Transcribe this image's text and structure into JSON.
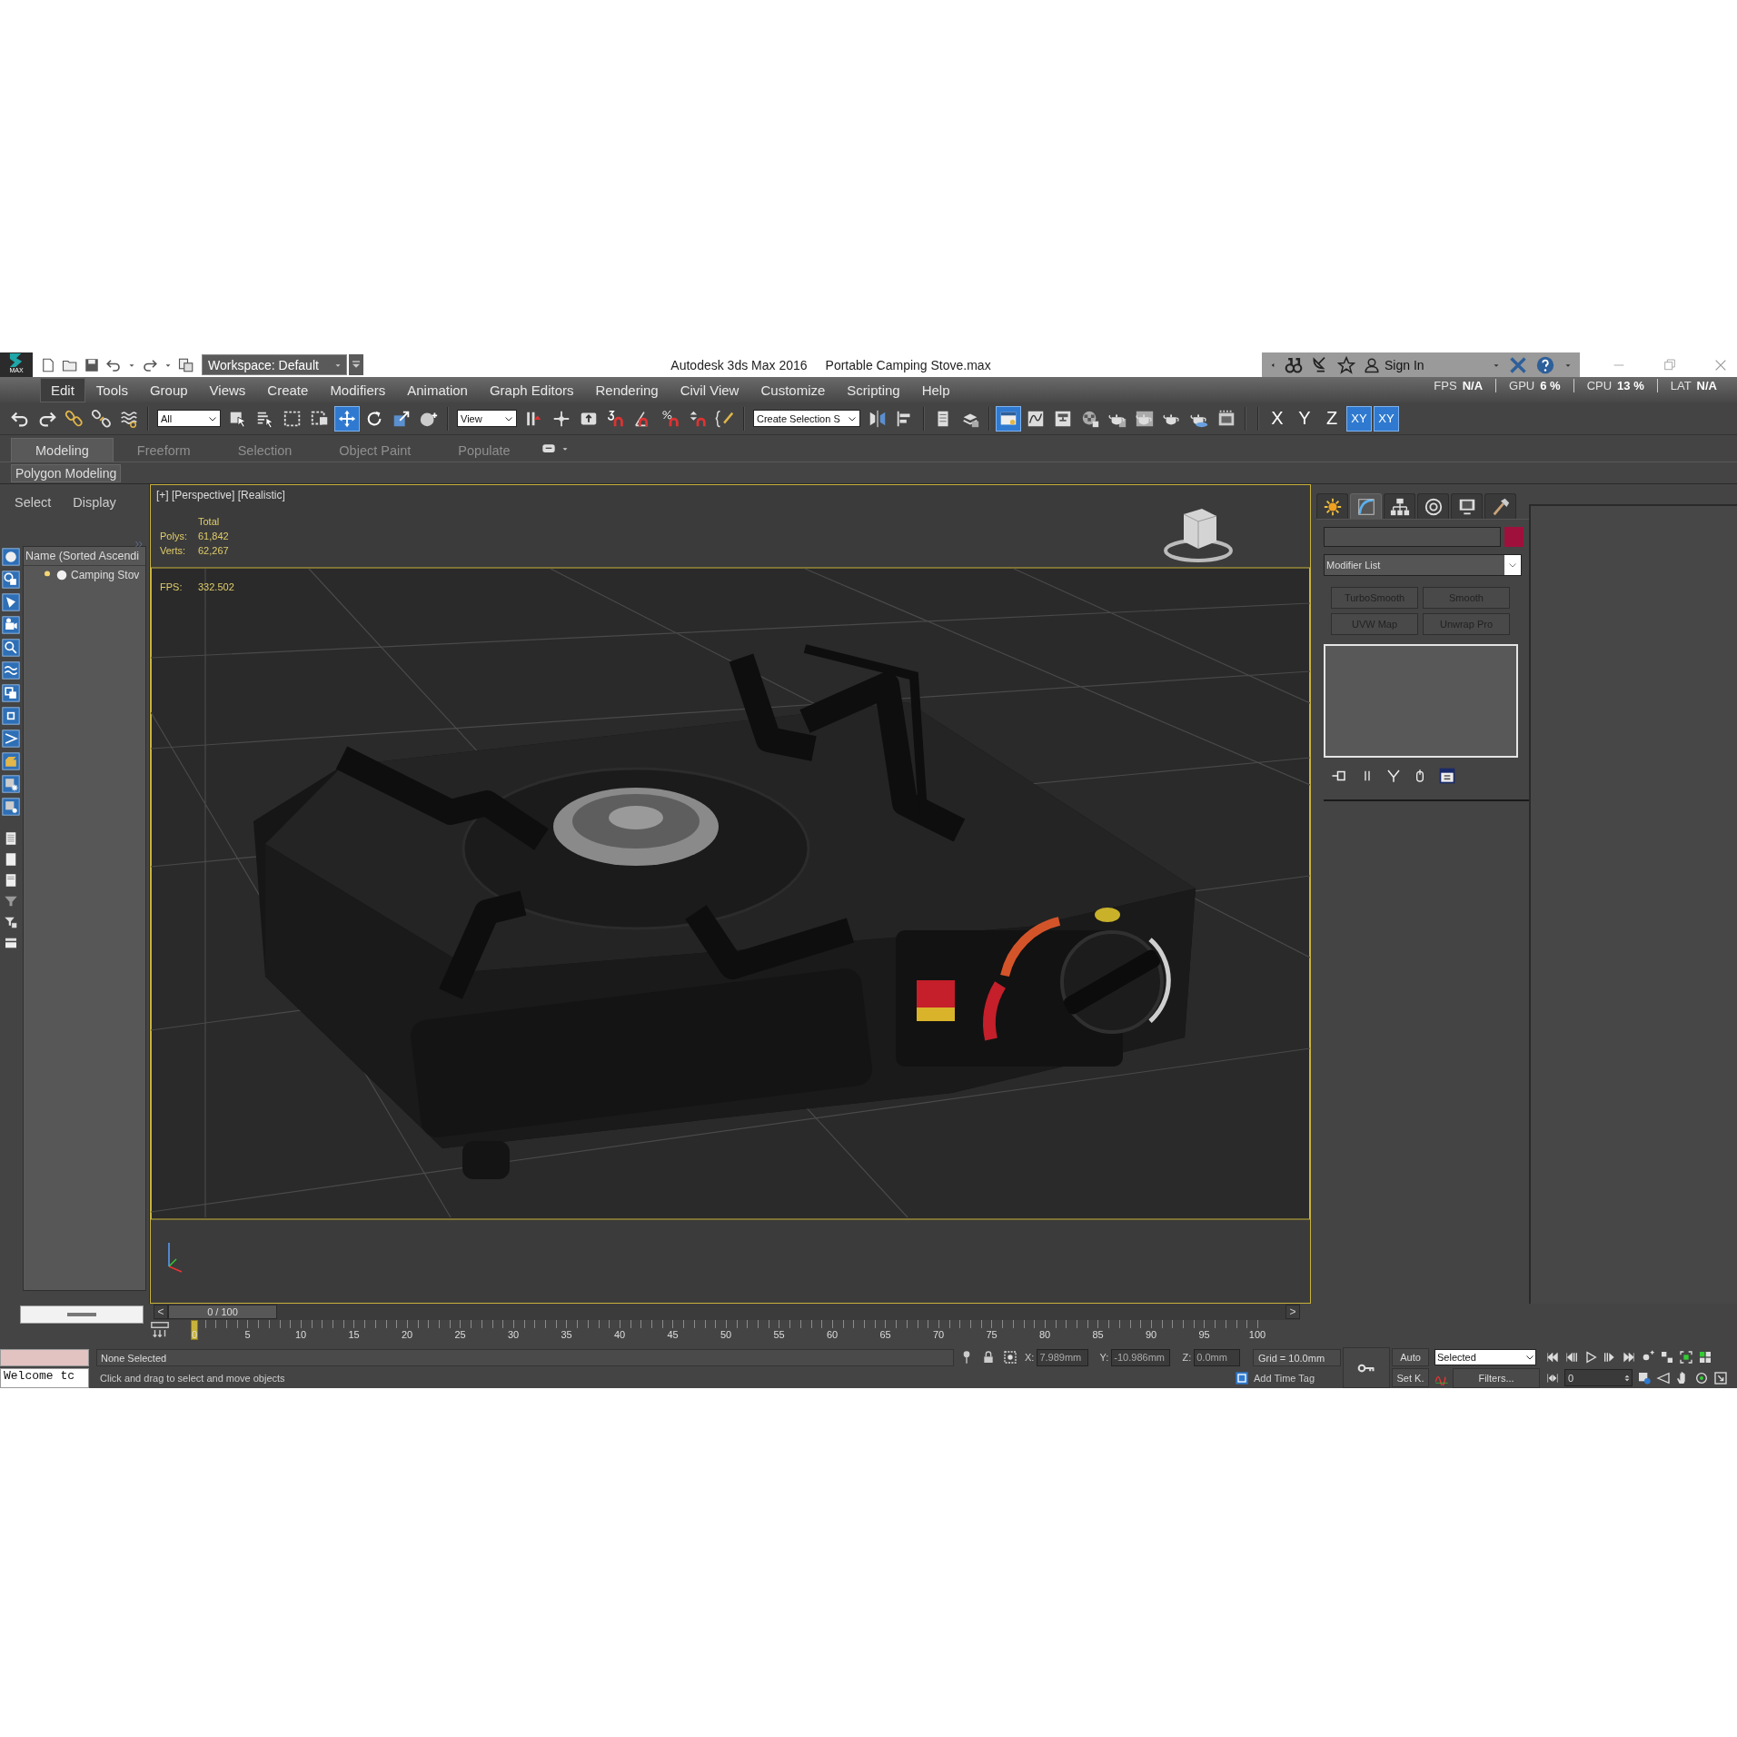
{
  "title_bar": {
    "app_menu_label": "MAX",
    "workspace": "Workspace: Default",
    "app_title": "Autodesk 3ds Max 2016",
    "file_name": "Portable Camping Stove.max",
    "sign_in": "Sign In"
  },
  "menu_bar": {
    "items": [
      {
        "label": "Edit",
        "selected": true
      },
      {
        "label": "Tools",
        "selected": false
      },
      {
        "label": "Group",
        "selected": false
      },
      {
        "label": "Views",
        "selected": false
      },
      {
        "label": "Create",
        "selected": false
      },
      {
        "label": "Modifiers",
        "selected": false
      },
      {
        "label": "Animation",
        "selected": false
      },
      {
        "label": "Graph Editors",
        "selected": false
      },
      {
        "label": "Rendering",
        "selected": false
      },
      {
        "label": "Civil View",
        "selected": false
      },
      {
        "label": "Customize",
        "selected": false
      },
      {
        "label": "Scripting",
        "selected": false
      },
      {
        "label": "Help",
        "selected": false
      }
    ],
    "performance": [
      {
        "label": "FPS",
        "value": "N/A"
      },
      {
        "label": "GPU",
        "value": "6 %"
      },
      {
        "label": "CPU",
        "value": "13 %"
      },
      {
        "label": "LAT",
        "value": "N/A"
      }
    ]
  },
  "main_toolbar": {
    "items": [
      {
        "kind": "undo",
        "selected": false
      },
      {
        "kind": "redo",
        "selected": false
      },
      {
        "kind": "link",
        "selected": false
      },
      {
        "kind": "unlink",
        "selected": false
      },
      {
        "kind": "bind",
        "selected": false
      },
      {
        "kind": "dropdown",
        "value": "All"
      },
      {
        "kind": "select",
        "selected": false
      },
      {
        "kind": "select-by-name",
        "selected": false
      },
      {
        "kind": "region",
        "selected": false
      },
      {
        "kind": "crossing",
        "selected": false
      },
      {
        "kind": "move",
        "selected": true
      },
      {
        "kind": "rotate",
        "selected": false
      },
      {
        "kind": "scale",
        "selected": false
      },
      {
        "kind": "placement",
        "selected": false
      },
      {
        "kind": "dropdown",
        "value": "View"
      },
      {
        "kind": "pivot",
        "selected": false
      },
      {
        "kind": "manipulate",
        "selected": false
      },
      {
        "kind": "shortcut",
        "selected": false
      },
      {
        "kind": "snap",
        "selected": false
      },
      {
        "kind": "angle-snap",
        "selected": false
      },
      {
        "kind": "percent-snap",
        "selected": false
      },
      {
        "kind": "spinner-snap",
        "selected": false
      },
      {
        "kind": "named-sets",
        "selected": false
      },
      {
        "kind": "dropdown",
        "value": "Create Selection S"
      },
      {
        "kind": "mirror",
        "selected": false
      },
      {
        "kind": "align",
        "selected": false
      },
      {
        "kind": "explorer",
        "selected": false
      },
      {
        "kind": "layers",
        "selected": false
      },
      {
        "kind": "ribbon",
        "selected": true
      },
      {
        "kind": "curve-editor",
        "selected": false
      },
      {
        "kind": "schematic",
        "selected": false
      },
      {
        "kind": "material",
        "selected": false
      },
      {
        "kind": "render-setup",
        "selected": false
      },
      {
        "kind": "frame-window",
        "selected": false
      },
      {
        "kind": "render",
        "selected": false
      },
      {
        "kind": "render-cloud",
        "selected": false
      },
      {
        "kind": "a360",
        "selected": false
      }
    ],
    "axis_constraints": [
      {
        "label": "X",
        "selected": false
      },
      {
        "label": "Y",
        "selected": false
      },
      {
        "label": "Z",
        "selected": false
      },
      {
        "label": "XY",
        "selected": true
      },
      {
        "label": "XY",
        "selected": true
      }
    ]
  },
  "ribbon": {
    "tabs": [
      {
        "label": "Modeling",
        "selected": true
      },
      {
        "label": "Freeform",
        "selected": false
      },
      {
        "label": "Selection",
        "selected": false
      },
      {
        "label": "Object Paint",
        "selected": false
      },
      {
        "label": "Populate",
        "selected": false
      }
    ],
    "panel": "Polygon Modeling"
  },
  "scene_explorer": {
    "menus": [
      "Select",
      "Display"
    ],
    "column": "Name (Sorted Ascendi",
    "items": [
      {
        "name": "Camping Stov"
      }
    ]
  },
  "viewport": {
    "label": "[+] [Perspective] [Realistic]",
    "stats_header": "Total",
    "stats": [
      {
        "label": "Polys:",
        "value": "61,842"
      },
      {
        "label": "Verts:",
        "value": "62,267"
      }
    ],
    "fps": {
      "label": "FPS:",
      "value": "332.502"
    }
  },
  "command_panel": {
    "tabs": [
      {
        "kind": "create",
        "selected": false
      },
      {
        "kind": "modify",
        "selected": true
      },
      {
        "kind": "hierarchy",
        "selected": false
      },
      {
        "kind": "motion",
        "selected": false
      },
      {
        "kind": "display",
        "selected": false
      },
      {
        "kind": "utilities",
        "selected": false
      }
    ],
    "modifier_list": "Modifier List",
    "modifier_buttons": [
      "TurboSmooth",
      "Smooth",
      "UVW Map",
      "Unwrap Pro"
    ]
  },
  "time_slider": {
    "prev": "<",
    "position": "0 / 100",
    "next": ">",
    "level": 0
  },
  "track_bar": {
    "labels": [
      "0",
      "5",
      "10",
      "15",
      "20",
      "25",
      "30",
      "35",
      "40",
      "45",
      "50",
      "55",
      "60",
      "65",
      "70",
      "75",
      "80",
      "85",
      "90",
      "95",
      "100"
    ]
  },
  "status_bar": {
    "maxscript_output": "Welcome tc",
    "selection_status": "None Selected",
    "prompt": "Click and drag to select and move objects",
    "coordinates": [
      {
        "label": "X:",
        "value": "7.989mm"
      },
      {
        "label": "Y:",
        "value": "-10.986mm"
      },
      {
        "label": "Z:",
        "value": "0.0mm"
      }
    ],
    "grid": "Grid = 10.0mm",
    "time_tag": "Add Time Tag",
    "auto_key": "Auto",
    "set_key": "Set K.",
    "key_filter": "Selected",
    "filters": "Filters...",
    "current_frame": "0"
  }
}
